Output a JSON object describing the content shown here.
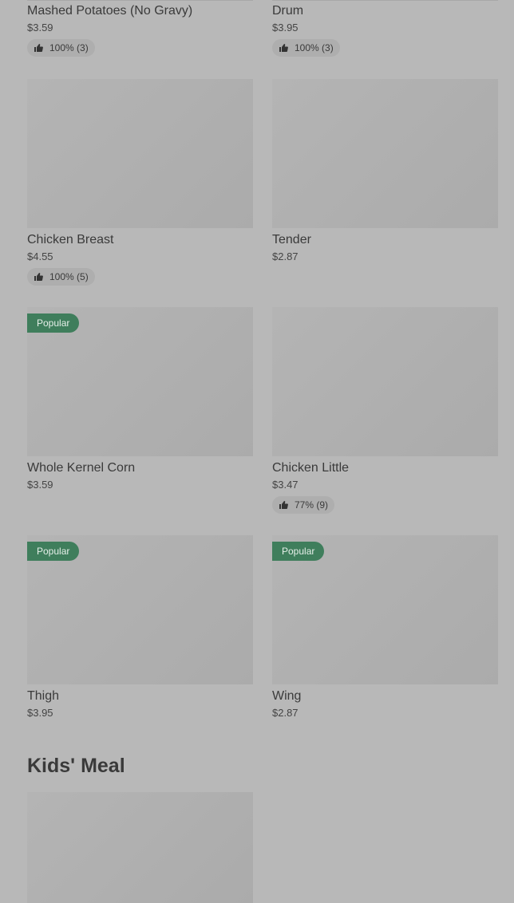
{
  "items": [
    {
      "id": "mashed",
      "name": "Mashed Potatoes (No Gravy)",
      "price": "$3.59",
      "rating": "100% (3)",
      "popular": false
    },
    {
      "id": "drum",
      "name": "Drum",
      "price": "$3.95",
      "rating": "100% (3)",
      "popular": false
    },
    {
      "id": "chicken-breast",
      "name": "Chicken Breast",
      "price": "$4.55",
      "rating": "100% (5)",
      "popular": false
    },
    {
      "id": "tender",
      "name": "Tender",
      "price": "$2.87",
      "rating": "",
      "popular": false
    },
    {
      "id": "corn",
      "name": "Whole Kernel Corn",
      "price": "$3.59",
      "rating": "",
      "popular": true
    },
    {
      "id": "chicken-little",
      "name": "Chicken Little",
      "price": "$3.47",
      "rating": "77% (9)",
      "popular": false
    },
    {
      "id": "thigh",
      "name": "Thigh",
      "price": "$3.95",
      "rating": "",
      "popular": true
    },
    {
      "id": "wing",
      "name": "Wing",
      "price": "$2.87",
      "rating": "",
      "popular": true
    }
  ],
  "badge_label": "Popular",
  "section": {
    "title": "Kids' Meal"
  },
  "colors": {
    "background": "#b8b8b8",
    "badge": "#3f7e5c"
  }
}
